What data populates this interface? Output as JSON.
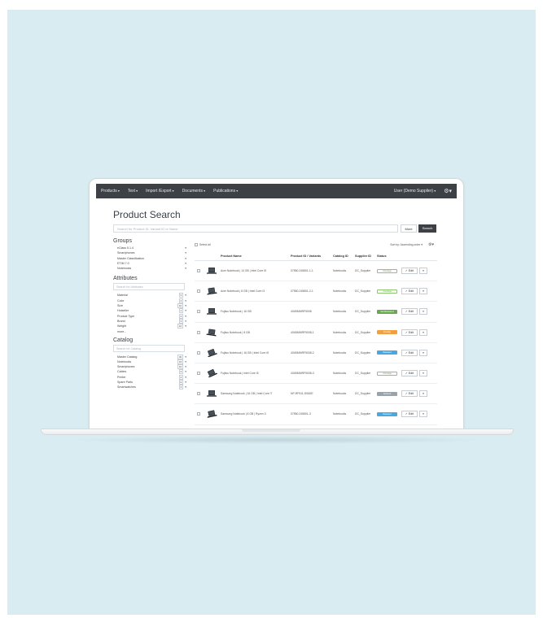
{
  "nav": {
    "items": [
      "Products",
      "Text",
      "Import /Export",
      "Documents",
      "Publications"
    ],
    "user": "User (Demo Supplier)",
    "settings_icon": "gear-icon"
  },
  "page": {
    "title": "Product Search",
    "search_placeholder": "Search for Product ID, Variant ID or Name",
    "more_label": "More",
    "search_label": "Search"
  },
  "groups": {
    "title": "Groups",
    "items": [
      "eClass 5.1.4",
      "Smartphones",
      "Master Classification",
      "ETIM 7.0",
      "Notebooks"
    ]
  },
  "attributes": {
    "title": "Attributes",
    "search_placeholder": "Search for Attributes",
    "items": [
      {
        "label": "Material",
        "count": "3"
      },
      {
        "label": "Color",
        "count": "4"
      },
      {
        "label": "Size",
        "count": "10"
      },
      {
        "label": "Hotseller",
        "count": "1"
      },
      {
        "label": "Product Type",
        "count": "3"
      },
      {
        "label": "Brand",
        "count": "3"
      },
      {
        "label": "Weight",
        "count": "10"
      }
    ],
    "more": "more..."
  },
  "catalog": {
    "title": "Catalog",
    "search_placeholder": "Search for Catalog",
    "items": [
      {
        "label": "Master Catalog",
        "count": "30"
      },
      {
        "label": "Notebooks",
        "count": "15"
      },
      {
        "label": "Smartphones",
        "count": "10"
      },
      {
        "label": "Cables",
        "count": "3"
      },
      {
        "label": "Printer",
        "count": "2"
      },
      {
        "label": "Spare Parts",
        "count": "9"
      },
      {
        "label": "Smartwatches",
        "count": "3"
      }
    ]
  },
  "results": {
    "select_all": "Select all",
    "sort_label": "Sort by: Ascending order",
    "columns": [
      "Product Name",
      "Product ID / Variants",
      "Catalog ID",
      "Supplier ID",
      "Status"
    ],
    "edit_label": "Edit",
    "rows": [
      {
        "name": "Acer Notebook | 14 GB | Intel Core i5",
        "id": "07550.245801-1-1",
        "catalog": "Notebooks",
        "supplier": "DC_Supplier",
        "status": "Inheritage",
        "status_color": "outline"
      },
      {
        "name": "Acer Notebook | 8 GB | Intel Core i3",
        "id": "07550.245801-2-1",
        "catalog": "Notebooks",
        "supplier": "DC_Supplier",
        "status": "Inheritage",
        "status_color": "outline"
      },
      {
        "name": "Fujitsu Notebook | 16 GB",
        "id": "4X65MMRF5008",
        "catalog": "Notebooks",
        "supplier": "DC_Supplier",
        "status": "Self-Maintained",
        "status_color": "green"
      },
      {
        "name": "Fujitsu Notebook | 8 GB",
        "id": "4X65MMRF5008-1",
        "catalog": "Notebooks",
        "supplier": "DC_Supplier",
        "status": "Pending",
        "status_color": "orange"
      },
      {
        "name": "Fujitsu Notebook | 16 GB | Intel Core i5",
        "id": "4X65MMRF5008-2",
        "catalog": "Notebooks",
        "supplier": "DC_Supplier",
        "status": "Released",
        "status_color": "blue"
      },
      {
        "name": "Fujitsu Notebook | Intel Core i5",
        "id": "4X65MMRF5008-3",
        "catalog": "Notebooks",
        "supplier": "DC_Supplier",
        "status": "Inheritage",
        "status_color": "outline"
      },
      {
        "name": "Samsung Notebook | 16 GB | Intel Core i7",
        "id": "NP-RF511-S06DE",
        "catalog": "Notebooks",
        "supplier": "DC_Supplier",
        "status": "Archived",
        "status_color": "gray"
      },
      {
        "name": "Samsung Notebook | 8 GB | Ryzen 3",
        "id": "07550.245801-3",
        "catalog": "Notebooks",
        "supplier": "DC_Supplier",
        "status": "Released",
        "status_color": "blue"
      }
    ]
  },
  "colors": {
    "background": "#d9ecf2",
    "nav": "#3d4146",
    "accent_green": "#6aa84f",
    "accent_orange": "#f0a040",
    "accent_blue": "#4aa8e0"
  }
}
